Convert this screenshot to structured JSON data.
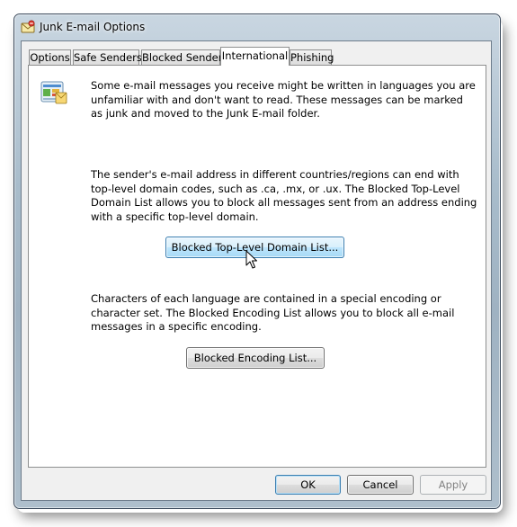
{
  "window": {
    "title": "Junk E-mail Options"
  },
  "tabs": [
    {
      "label": "Options",
      "active": false
    },
    {
      "label": "Safe Senders",
      "active": false
    },
    {
      "label": "Blocked Senders",
      "active": false
    },
    {
      "label": "International",
      "active": true
    },
    {
      "label": "Phishing",
      "active": false
    }
  ],
  "international": {
    "intro_text": "Some e-mail messages you receive might be written in languages you are unfamiliar with and don't want to read.  These messages can be marked as junk and moved to the Junk E-mail folder.",
    "domain_text": "The sender's e-mail address in different countries/regions can end with top-level domain codes, such as .ca, .mx, or .ux.  The Blocked Top-Level Domain List allows you to block all messages sent from an address ending with a specific top-level domain.",
    "domain_button": "Blocked Top-Level Domain List...",
    "encoding_text": "Characters of each language are contained in a special encoding or character set.  The Blocked Encoding List allows you to block all e-mail messages in a specific encoding.",
    "encoding_button": "Blocked Encoding List..."
  },
  "footer": {
    "ok_label": "OK",
    "cancel_label": "Cancel",
    "apply_label": "Apply",
    "apply_enabled": false
  },
  "icons": {
    "app": "junk-mail-envelope-icon",
    "section": "globe-mail-icon",
    "cursor": "mouse-pointer-icon"
  }
}
